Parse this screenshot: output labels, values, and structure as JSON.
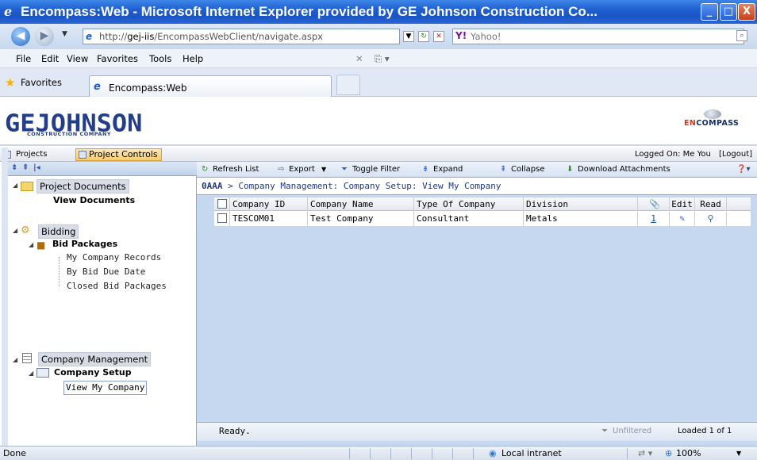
{
  "window": {
    "title": "Encompass:Web - Microsoft Internet Explorer provided by GE Johnson Construction Co...",
    "controls": [
      "_",
      "□",
      "X"
    ]
  },
  "address": {
    "url_prefix": "http://",
    "url_host": "gej-iis",
    "url_path": "/EncompassWebClient/navigate.aspx",
    "search_placeholder": "Yahoo!"
  },
  "menu": [
    "File",
    "Edit",
    "View",
    "Favorites",
    "Tools",
    "Help"
  ],
  "favorites": {
    "label": "Favorites",
    "tab_title": "Encompass:Web"
  },
  "banner": {
    "logo": "GEJOHNSON",
    "logo_sub": "CONSTRUCTION COMPANY",
    "brand_prefix": "EN",
    "brand_rest": "COMPASS"
  },
  "apptabs": {
    "projects": "Projects",
    "project_controls": "Project Controls",
    "logged_on": "Logged On: Me You",
    "logout": "[Logout]"
  },
  "tree": {
    "project_documents": "Project Documents",
    "view_documents": "View Documents",
    "bidding": "Bidding",
    "bid_packages": "Bid Packages",
    "my_company_records": "My Company Records",
    "by_bid_due_date": "By Bid Due Date",
    "closed_bid_packages": "Closed Bid Packages",
    "company_management": "Company Management",
    "company_setup": "Company Setup",
    "view_my_company": "View My Company"
  },
  "toolbar": {
    "refresh": "Refresh List",
    "export": "Export",
    "toggle_filter": "Toggle Filter",
    "expand": "Expand",
    "collapse": "Collapse",
    "download": "Download Attachments"
  },
  "breadcrumb": {
    "project": "0AAA",
    "sep": ">",
    "path": "Company Management: Company Setup: View My Company"
  },
  "grid": {
    "columns": [
      "Company ID",
      "Company Name",
      "Type Of Company",
      "Division",
      "Edit",
      "Read"
    ],
    "rows": [
      {
        "company_id": "TESCOM01",
        "company_name": "Test Company",
        "type": "Consultant",
        "division": "Metals",
        "attachments": "1"
      }
    ]
  },
  "status": {
    "ready": "Ready.",
    "unfiltered": "Unfiltered",
    "loaded": "Loaded 1 of 1"
  },
  "ie_status": {
    "done": "Done",
    "zone": "Local intranet",
    "zoom": "100%"
  },
  "colors": {
    "title_blue": "#1f5fd0",
    "logo_blue": "#233e88",
    "grid_bg": "#c6d8f0",
    "active_tab": "#f7cc6e"
  }
}
